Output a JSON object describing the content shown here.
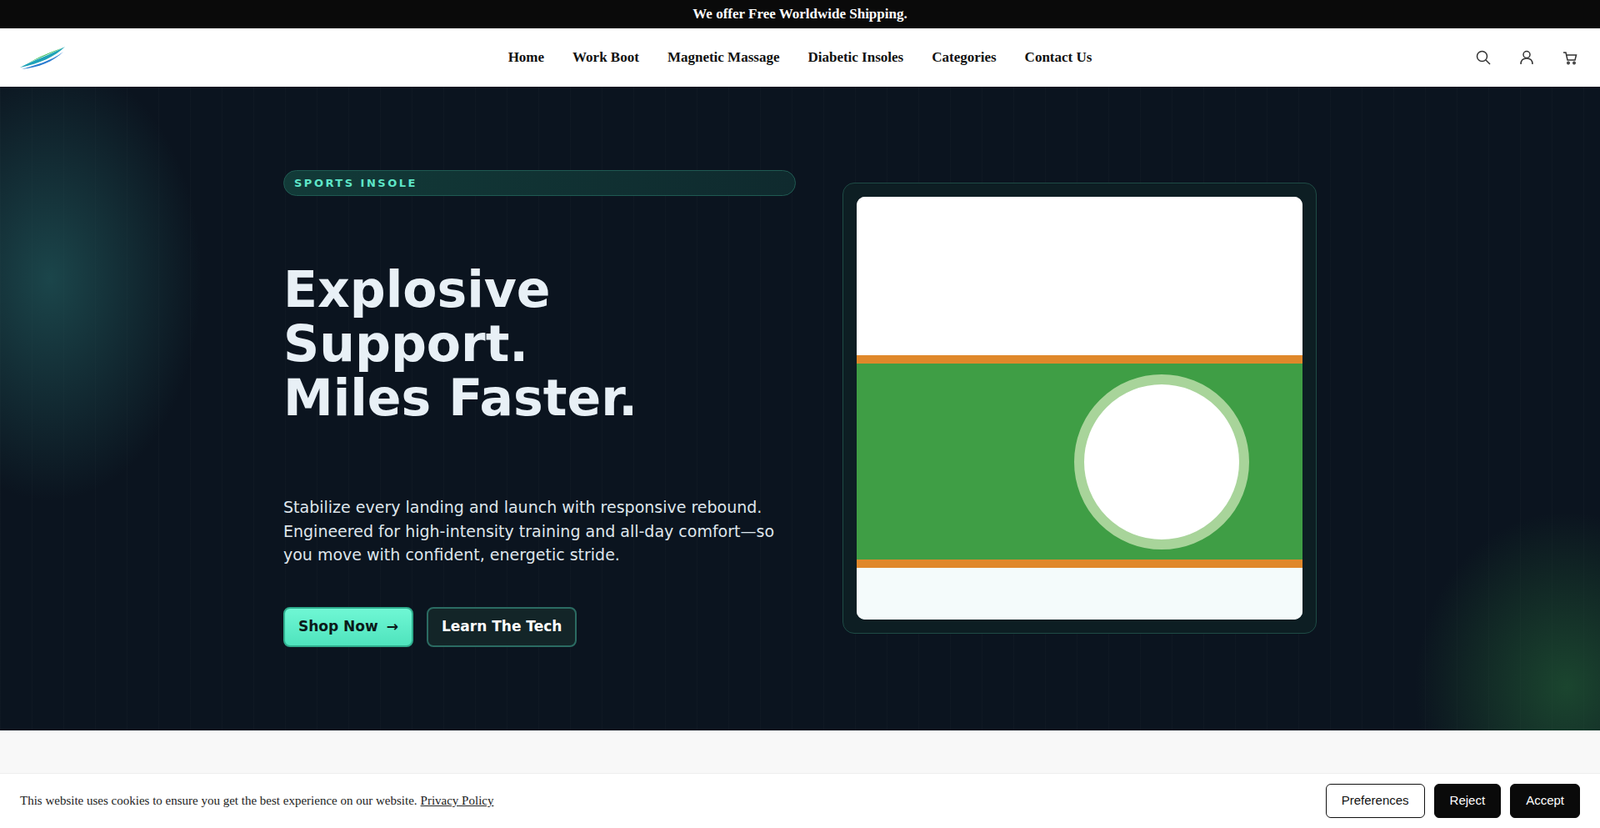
{
  "announcement": "We offer Free Worldwide Shipping.",
  "nav": {
    "items": [
      "Home",
      "Work Boot",
      "Magnetic Massage",
      "Diabetic Insoles",
      "Categories",
      "Contact Us"
    ]
  },
  "hero": {
    "badge": "SPORTS INSOLE",
    "headline": [
      "Explosive",
      "Support.",
      "Miles Faster."
    ],
    "text": "Stabilize every landing and launch with responsive rebound. Engineered for high-intensity training and all-day comfort—so you move with confident, energetic stride.",
    "buttons": [
      {
        "label": "Shop Now",
        "icon": "→",
        "kind": "primary"
      },
      {
        "label": "Learn The Tech",
        "kind": "secondary"
      }
    ]
  },
  "cookie_bar": {
    "text": "This website uses cookies to ensure you get the best experience on our website.",
    "link": "Privacy Policy",
    "buttons": [
      {
        "label": "Preferences",
        "kind": "outline"
      },
      {
        "label": "Reject",
        "kind": "solid"
      },
      {
        "label": "Accept",
        "kind": "solid"
      }
    ]
  }
}
